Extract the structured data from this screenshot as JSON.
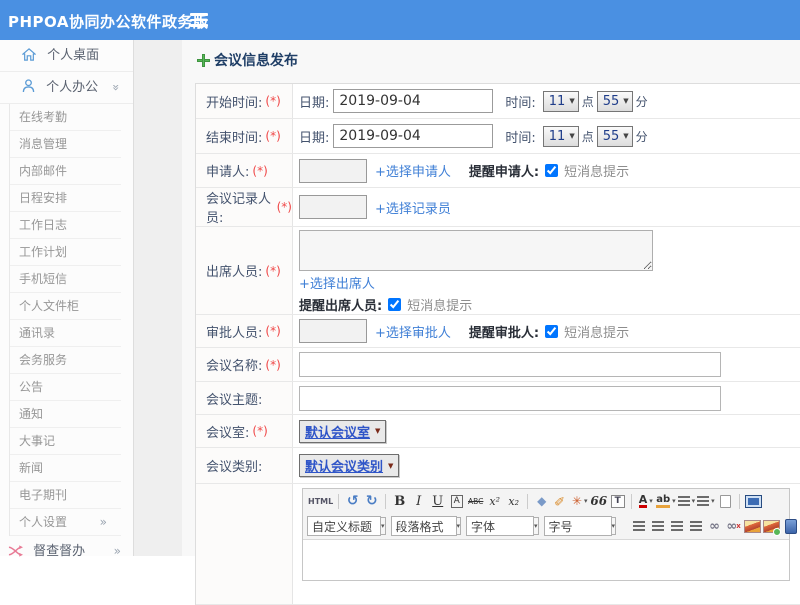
{
  "colors": {
    "header_bg": "#4a90e2",
    "icon_blue": "#5b9bd5",
    "link_blue": "#3f7fd6",
    "required_red": "#f04848",
    "plus_green": "#57b757",
    "supervise_pink": "#e87a95"
  },
  "icons": [
    "hamburger-menu-icon",
    "home-icon",
    "user-icon",
    "double-chevron-icon",
    "shuffle-icon",
    "add-icon",
    "dropdown-triangle-icon"
  ],
  "header": {
    "app_title": "PHPOA协同办公软件政务版"
  },
  "sidebar": {
    "desktop_label": "个人桌面",
    "office_label": "个人办公",
    "chevron": "»",
    "sub_items": [
      "在线考勤",
      "消息管理",
      "内部邮件",
      "日程安排",
      "工作日志",
      "工作计划",
      "手机短信",
      "个人文件柜",
      "通讯录",
      "会务服务",
      "公告",
      "通知",
      "大事记",
      "新闻",
      "电子期刊"
    ],
    "settings_label": "个人设置",
    "supervise_label": "督查督办"
  },
  "page": {
    "title": "会议信息发布"
  },
  "form": {
    "select_arrow": "▼",
    "start": {
      "label": "开始时间:",
      "req": "(*)",
      "date_label": "日期:",
      "date_value": "2019-09-04",
      "time_label": "时间:",
      "hour": "11",
      "hour_unit": "点",
      "minute": "55",
      "minute_unit": "分"
    },
    "end": {
      "label": "结束时间:",
      "req": "(*)",
      "date_label": "日期:",
      "date_value": "2019-09-04",
      "time_label": "时间:",
      "hour": "11",
      "hour_unit": "点",
      "minute": "55",
      "minute_unit": "分"
    },
    "applicant": {
      "label": "申请人:",
      "req": "(*)",
      "value": "",
      "link": "+选择申请人",
      "remind": "提醒申请人:",
      "sms": "短消息提示",
      "checked": true
    },
    "recorder": {
      "label": "会议记录人员:",
      "req": "(*)",
      "value": "",
      "link": "+选择记录员"
    },
    "attendee": {
      "label": "出席人员:",
      "req": "(*)",
      "value": "",
      "link": "+选择出席人",
      "remind": "提醒出席人员:",
      "sms": "短消息提示",
      "checked": true
    },
    "approver": {
      "label": "审批人员:",
      "req": "(*)",
      "value": "",
      "link": "+选择审批人",
      "remind": "提醒审批人:",
      "sms": "短消息提示",
      "checked": true
    },
    "name": {
      "label": "会议名称:",
      "req": "(*)",
      "value": ""
    },
    "topic": {
      "label": "会议主题:",
      "value": ""
    },
    "room": {
      "label": "会议室:",
      "req": "(*)",
      "value": "默认会议室"
    },
    "category": {
      "label": "会议类别:",
      "value": "默认会议类别"
    }
  },
  "editor": {
    "arrow": "▾",
    "row1": {
      "html": "HTML",
      "undo": "↺",
      "redo": "↻",
      "bold": "B",
      "italic": "I",
      "underline": "U",
      "font_box": "A",
      "strikethrough": "ABC",
      "superscript": "x²",
      "subscript": "x₂",
      "eraser": "◆",
      "brush": "✎",
      "wand": "✳",
      "quote": "66",
      "paste_text": "T",
      "font_color": "A",
      "highlight": "ab"
    },
    "row2": {
      "heading": "自定义标题",
      "paragraph": "段落格式",
      "font_family": "字体",
      "font_size": "字号",
      "link_glyph": "∞",
      "unlink_glyph": "∞",
      "unlink_x": "x",
      "table_glyph": "⊞"
    }
  }
}
